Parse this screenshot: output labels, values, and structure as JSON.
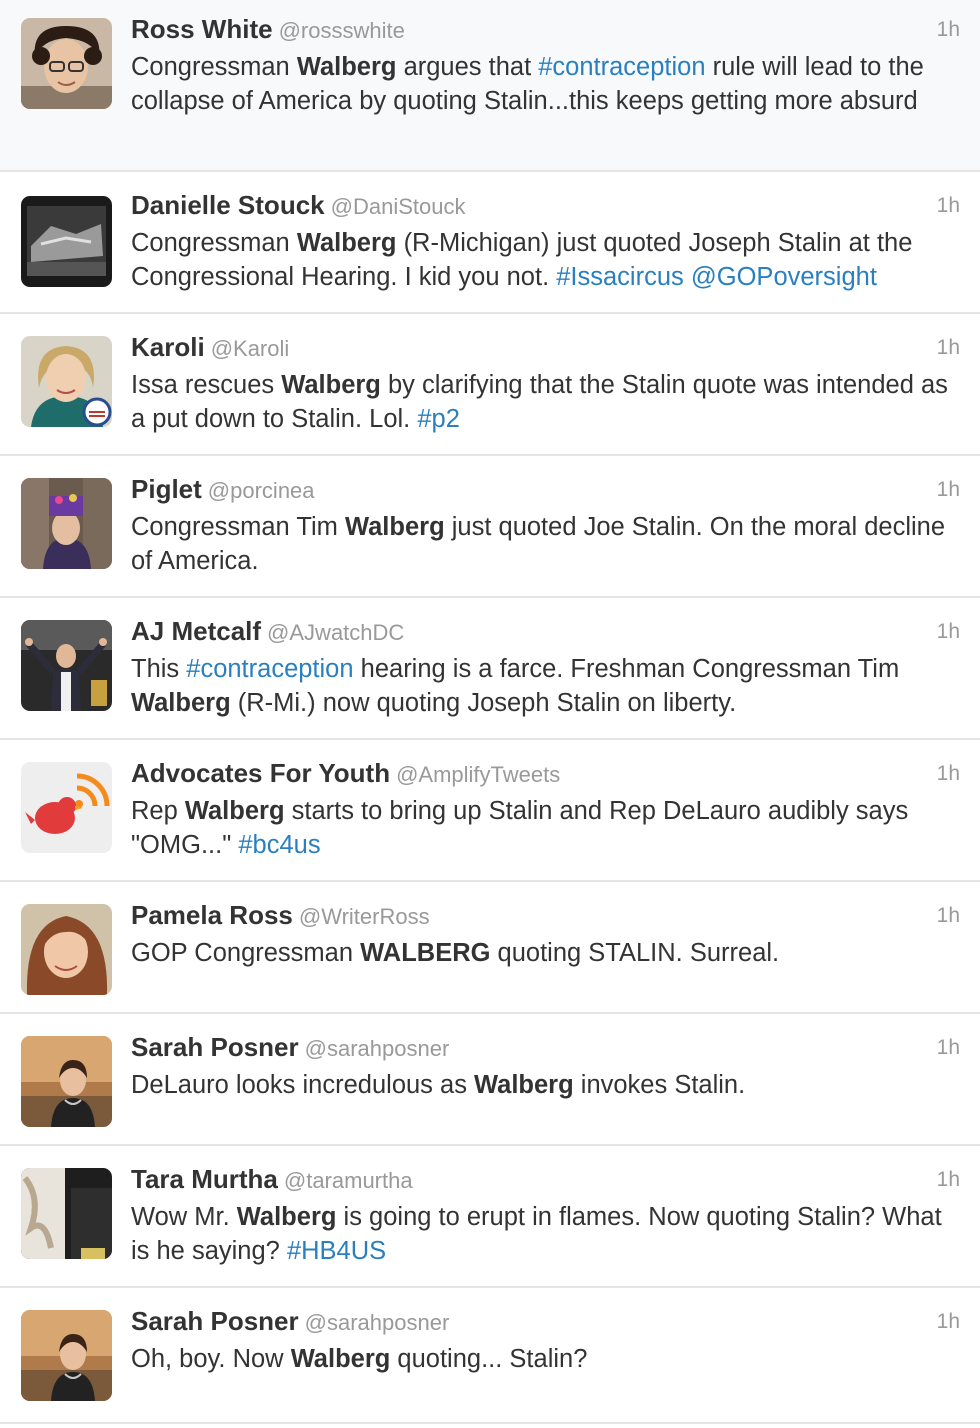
{
  "tweets": [
    {
      "name": "Ross White",
      "handle": "@rossswhite",
      "time": "1h",
      "avatar": "avatar-curly-hair-glasses",
      "body": [
        {
          "t": "Congressman "
        },
        {
          "t": "Walberg",
          "s": "b"
        },
        {
          "t": " argues that "
        },
        {
          "t": "#contraception",
          "s": "link"
        },
        {
          "t": " rule will lead to the collapse of America by quoting Stalin...this keeps getting more absurd"
        }
      ]
    },
    {
      "name": "Danielle Stouck",
      "handle": "@DaniStouck",
      "time": "1h",
      "avatar": "avatar-bw-photo",
      "body": [
        {
          "t": "Congressman "
        },
        {
          "t": "Walberg",
          "s": "b"
        },
        {
          "t": " (R-Michigan) just quoted Joseph Stalin at the Congressional Hearing. I kid you not. "
        },
        {
          "t": "#Issacircus",
          "s": "link"
        },
        {
          "t": " "
        },
        {
          "t": "@GOPoversight",
          "s": "link"
        }
      ]
    },
    {
      "name": "Karoli",
      "handle": "@Karoli",
      "time": "1h",
      "avatar": "avatar-blonde-badge",
      "body": [
        {
          "t": "Issa rescues "
        },
        {
          "t": "Walberg",
          "s": "b"
        },
        {
          "t": " by clarifying that the Stalin quote was intended as a put down to Stalin. Lol. "
        },
        {
          "t": "#p2",
          "s": "link"
        }
      ]
    },
    {
      "name": "Piglet",
      "handle": "@porcinea",
      "time": "1h",
      "avatar": "avatar-hat-street",
      "body": [
        {
          "t": "Congressman Tim "
        },
        {
          "t": "Walberg",
          "s": "b"
        },
        {
          "t": " just quoted Joe Stalin. On the moral decline of America."
        }
      ]
    },
    {
      "name": "AJ Metcalf",
      "handle": "@AJwatchDC",
      "time": "1h",
      "avatar": "avatar-arms-raised",
      "body": [
        {
          "t": "This "
        },
        {
          "t": "#contraception",
          "s": "link"
        },
        {
          "t": " hearing is a farce. Freshman Congressman Tim "
        },
        {
          "t": "Walberg",
          "s": "b"
        },
        {
          "t": " (R-Mi.) now quoting Joseph Stalin on liberty."
        }
      ]
    },
    {
      "name": "Advocates For Youth",
      "handle": "@AmplifyTweets",
      "time": "1h",
      "avatar": "avatar-red-bird-logo",
      "body": [
        {
          "t": "Rep "
        },
        {
          "t": "Walberg",
          "s": "b"
        },
        {
          "t": " starts to bring up Stalin and Rep DeLauro audibly says \"OMG...\" "
        },
        {
          "t": "#bc4us",
          "s": "link"
        }
      ]
    },
    {
      "name": "Pamela Ross",
      "handle": "@WriterRoss",
      "time": "1h",
      "avatar": "avatar-auburn-hair",
      "body": [
        {
          "t": "GOP Congressman "
        },
        {
          "t": "WALBERG",
          "s": "b"
        },
        {
          "t": " quoting STALIN. Surreal."
        }
      ]
    },
    {
      "name": "Sarah Posner",
      "handle": "@sarahposner",
      "time": "1h",
      "avatar": "avatar-smiling-woman",
      "body": [
        {
          "t": "DeLauro looks incredulous as "
        },
        {
          "t": "Walberg",
          "s": "b"
        },
        {
          "t": " invokes Stalin."
        }
      ]
    },
    {
      "name": "Tara Murtha",
      "handle": "@taramurtha",
      "time": "1h",
      "avatar": "avatar-dark-photo",
      "body": [
        {
          "t": "Wow Mr. "
        },
        {
          "t": "Walberg",
          "s": "b"
        },
        {
          "t": " is going to erupt in flames. Now quoting Stalin? What is he saying? "
        },
        {
          "t": "#HB4US",
          "s": "link"
        }
      ]
    },
    {
      "name": "Sarah Posner",
      "handle": "@sarahposner",
      "time": "1h",
      "avatar": "avatar-smiling-woman",
      "body": [
        {
          "t": "Oh, boy. Now "
        },
        {
          "t": "Walberg",
          "s": "b"
        },
        {
          "t": " quoting... Stalin?"
        }
      ]
    }
  ],
  "colors": {
    "link": "#2a7fbf",
    "text": "#333333",
    "muted": "#999999",
    "divider": "#e5e5e5",
    "favorite_star": "#f2b100"
  }
}
